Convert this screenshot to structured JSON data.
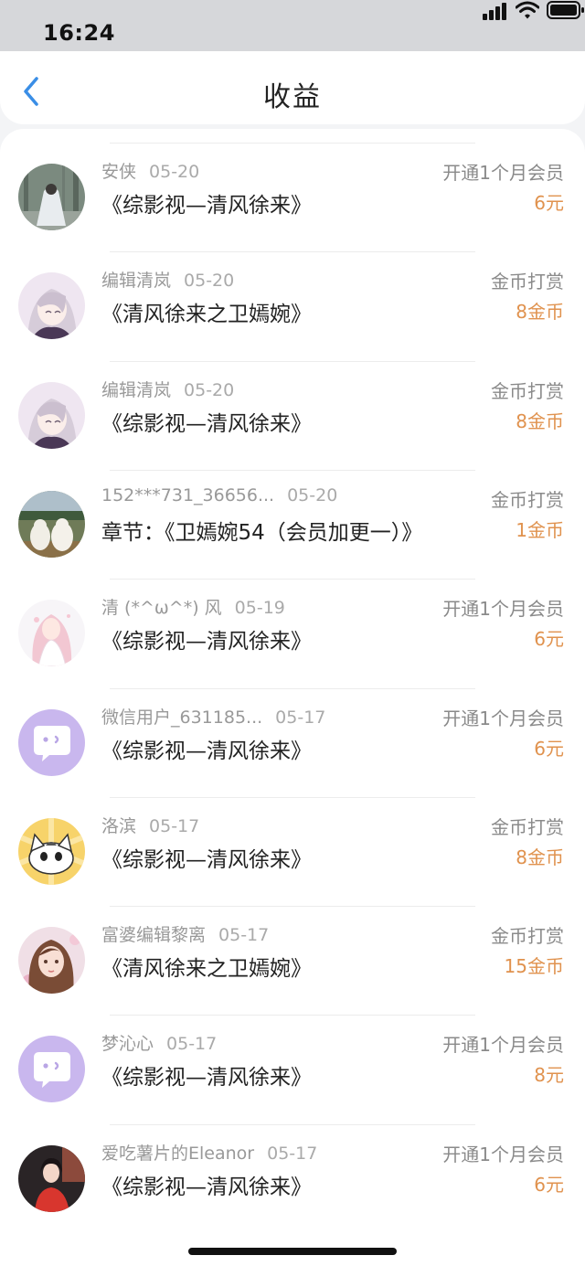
{
  "status_bar": {
    "time": "16:24"
  },
  "header": {
    "title": "收益",
    "back_icon": "chevron-left-icon"
  },
  "colors": {
    "accent": "#3a8ee6",
    "amount": "#e0924e",
    "avatar_purple": "#c9b7ee"
  },
  "records": [
    {
      "name": "安侠",
      "date": "05-20",
      "title": "《综影视—清风徐来》",
      "type": "开通1个月会员",
      "amount": "6元",
      "avatar": "forest-girl-avatar"
    },
    {
      "name": "编辑清岚",
      "date": "05-20",
      "title": "《清风徐来之卫嫣婉》",
      "type": "金币打赏",
      "amount": "8金币",
      "avatar": "anime-silver-hair-avatar"
    },
    {
      "name": "编辑清岚",
      "date": "05-20",
      "title": "《综影视—清风徐来》",
      "type": "金币打赏",
      "amount": "8金币",
      "avatar": "anime-silver-hair-avatar"
    },
    {
      "name": "152***731_36656...",
      "date": "05-20",
      "title": "章节：《卫嫣婉54（会员加更一）》",
      "type": "金币打赏",
      "amount": "1金币",
      "avatar": "two-dogs-avatar"
    },
    {
      "name": "清 (*^ω^*) 风",
      "date": "05-19",
      "title": "《综影视—清风徐来》",
      "type": "开通1个月会员",
      "amount": "6元",
      "avatar": "pink-hair-girl-avatar"
    },
    {
      "name": "微信用户_631185...",
      "date": "05-17",
      "title": "《综影视—清风徐来》",
      "type": "开通1个月会员",
      "amount": "6元",
      "avatar": "chat-bubble-avatar"
    },
    {
      "name": "洛滨",
      "date": "05-17",
      "title": "《综影视—清风徐来》",
      "type": "金币打赏",
      "amount": "8金币",
      "avatar": "cartoon-cat-avatar"
    },
    {
      "name": "富婆编辑黎离",
      "date": "05-17",
      "title": "《清风徐来之卫嫣婉》",
      "type": "金币打赏",
      "amount": "15金币",
      "avatar": "brown-hair-girl-avatar"
    },
    {
      "name": "梦沁心",
      "date": "05-17",
      "title": "《综影视—清风徐来》",
      "type": "开通1个月会员",
      "amount": "8元",
      "avatar": "chat-bubble-avatar"
    },
    {
      "name": "爱吃薯片的Eleanor",
      "date": "05-17",
      "title": "《综影视—清风徐来》",
      "type": "开通1个月会员",
      "amount": "6元",
      "avatar": "red-dress-girl-avatar"
    }
  ]
}
